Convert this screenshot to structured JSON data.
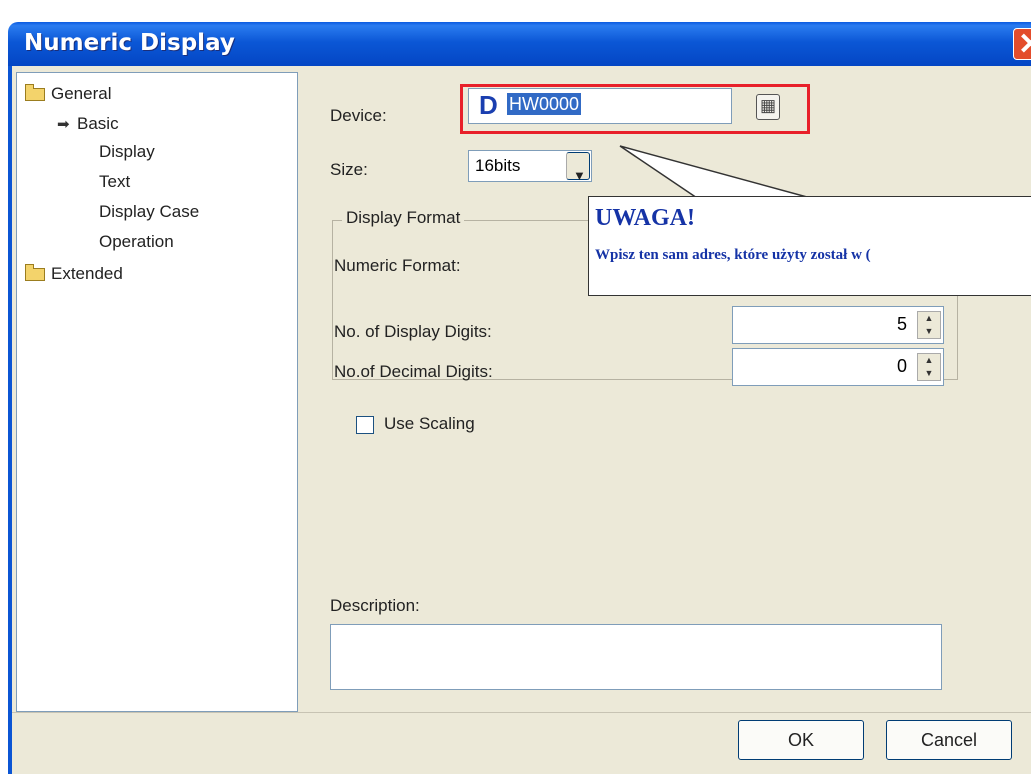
{
  "window": {
    "title": "Numeric Display",
    "close_glyph": "✕"
  },
  "tree": {
    "general": "General",
    "items": [
      {
        "label": "Basic",
        "selected": true,
        "marker": "➡"
      },
      {
        "label": "Display"
      },
      {
        "label": "Text"
      },
      {
        "label": "Display Case"
      },
      {
        "label": "Operation"
      }
    ],
    "extended": "Extended"
  },
  "form": {
    "device_label": "Device:",
    "device_prefix": "D",
    "device_value": "HW0000",
    "size_label": "Size:",
    "size_value": "16bits",
    "group_title": "Display Format",
    "numeric_format_label": "Numeric Format:",
    "display_digits_label": "No. of Display Digits:",
    "display_digits_value": "5",
    "decimal_digits_label": "No.of Decimal Digits:",
    "decimal_digits_value": "0",
    "use_scaling_label": "Use Scaling",
    "use_scaling_checked": false,
    "description_label": "Description:",
    "description_value": ""
  },
  "callout": {
    "heading": "UWAGA!",
    "text": "Wpisz ten sam adres, które użyty został w ("
  },
  "buttons": {
    "ok": "OK",
    "cancel": "Cancel"
  },
  "colors": {
    "titlebar": "#0b57d6",
    "highlight_border": "#e8202a",
    "callout_text": "#1533a6"
  },
  "icons": [
    "folder-icon",
    "arrow-right-icon",
    "calculator-icon",
    "chevron-down-icon",
    "spin-arrows-icon",
    "close-icon"
  ]
}
